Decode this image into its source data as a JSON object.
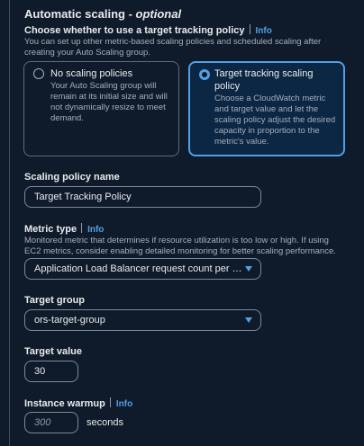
{
  "header": {
    "title": "Automatic scaling - ",
    "title_optional": "optional",
    "question": "Choose whether to use a target tracking policy",
    "info": "Info",
    "description": "You can set up other metric-based scaling policies and scheduled scaling after creating your Auto Scaling group."
  },
  "options": [
    {
      "title": "No scaling policies",
      "description": "Your Auto Scaling group will remain at its initial size and will not dynamically resize to meet demand.",
      "selected": false
    },
    {
      "title": "Target tracking scaling policy",
      "description": "Choose a CloudWatch metric and target value and let the scaling policy adjust the desired capacity in proportion to the metric's value.",
      "selected": true
    }
  ],
  "policy_name": {
    "label": "Scaling policy name",
    "value": "Target Tracking Policy"
  },
  "metric_type": {
    "label": "Metric type",
    "info": "Info",
    "description": "Monitored metric that determines if resource utilization is too low or high. If using EC2 metrics, consider enabling detailed monitoring for better scaling performance.",
    "value": "Application Load Balancer request count per target"
  },
  "target_group": {
    "label": "Target group",
    "value": "ors-target-group"
  },
  "target_value": {
    "label": "Target value",
    "value": "30"
  },
  "instance_warmup": {
    "label": "Instance warmup",
    "info": "Info",
    "placeholder": "300",
    "unit": "seconds"
  },
  "colors": {
    "background": "#0f1b2a",
    "accent": "#539fe5",
    "selected_card_bg": "#0c2743",
    "border": "#7d8998"
  }
}
